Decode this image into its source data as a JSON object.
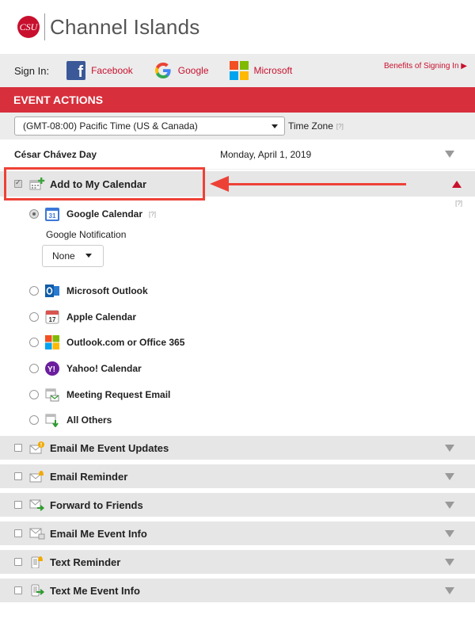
{
  "header": {
    "logo_mark": "CSU",
    "logo_text": "Channel Islands"
  },
  "signin": {
    "label": "Sign In:",
    "providers": [
      {
        "name": "Facebook",
        "icon": "facebook-icon"
      },
      {
        "name": "Google",
        "icon": "google-icon"
      },
      {
        "name": "Microsoft",
        "icon": "microsoft-icon"
      }
    ],
    "benefits_link": "Benefits of Signing In"
  },
  "event_actions": {
    "title": "EVENT ACTIONS"
  },
  "timezone": {
    "selected": "(GMT-08:00) Pacific Time (US & Canada)",
    "label": "Time Zone",
    "help": "[?]"
  },
  "event": {
    "name": "César Chávez Day",
    "date": "Monday, April 1, 2019"
  },
  "add_to_calendar": {
    "label": "Add to My Calendar",
    "checked": true,
    "help": "[?]",
    "options": [
      {
        "label": "Google Calendar",
        "icon": "google-calendar-icon",
        "selected": true,
        "help": "[?]"
      },
      {
        "label": "Microsoft Outlook",
        "icon": "outlook-icon",
        "selected": false
      },
      {
        "label": "Apple Calendar",
        "icon": "apple-calendar-icon",
        "selected": false
      },
      {
        "label": "Outlook.com or Office 365",
        "icon": "office365-icon",
        "selected": false
      },
      {
        "label": "Yahoo! Calendar",
        "icon": "yahoo-icon",
        "selected": false
      },
      {
        "label": "Meeting Request Email",
        "icon": "meeting-request-icon",
        "selected": false
      },
      {
        "label": "All Others",
        "icon": "calendar-download-icon",
        "selected": false
      }
    ],
    "google_notification": {
      "label": "Google Notification",
      "value": "None"
    }
  },
  "actions": [
    {
      "label": "Email Me Event Updates",
      "icon": "email-alert-icon"
    },
    {
      "label": "Email Reminder",
      "icon": "email-bell-icon"
    },
    {
      "label": "Forward to Friends",
      "icon": "email-forward-icon"
    },
    {
      "label": "Email Me Event Info",
      "icon": "email-info-icon"
    },
    {
      "label": "Text Reminder",
      "icon": "phone-bell-icon"
    },
    {
      "label": "Text Me Event Info",
      "icon": "phone-forward-icon"
    }
  ],
  "colors": {
    "brand_red": "#c8102e",
    "header_red": "#d72f3c",
    "annotation_red": "#ee4136"
  }
}
